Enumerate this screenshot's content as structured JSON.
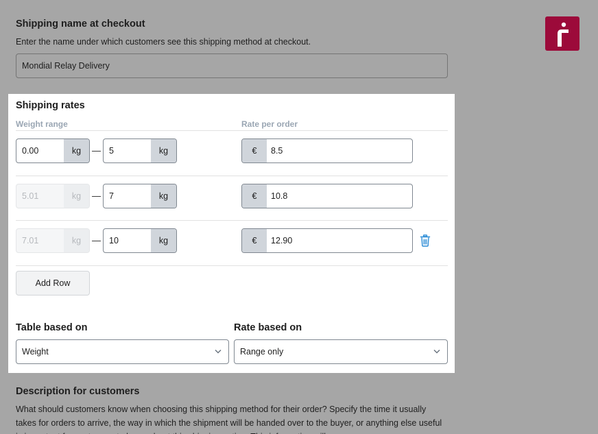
{
  "shipping_name": {
    "title": "Shipping name at checkout",
    "help": "Enter the name under which customers see this shipping method at checkout.",
    "value": "Mondial Relay Delivery"
  },
  "logo": {
    "name": "mondial-relay-logo",
    "color": "#9c0a3a"
  },
  "rates": {
    "title": "Shipping rates",
    "col_weight": "Weight range",
    "col_rate": "Rate per order",
    "rows": [
      {
        "from": "0.00",
        "from_unit": "kg",
        "to": "5",
        "to_unit": "kg",
        "currency": "€",
        "rate": "8.5"
      },
      {
        "from": "5.01",
        "from_unit": "kg",
        "to": "7",
        "to_unit": "kg",
        "currency": "€",
        "rate": "10.8"
      },
      {
        "from": "7.01",
        "from_unit": "kg",
        "to": "10",
        "to_unit": "kg",
        "currency": "€",
        "rate": "12.90",
        "delete_icon": "trash-icon"
      }
    ],
    "dash": "—",
    "add_row": "Add Row"
  },
  "table_based_on": {
    "label": "Table based on",
    "value": "Weight"
  },
  "rate_based_on": {
    "label": "Rate based on",
    "value": "Range only"
  },
  "description": {
    "title": "Description for customers",
    "text": "What should customers know when choosing this shipping method for their order? Specify the time it usually takes for orders to arrive, the way in which the shipment will be handed over to the buyer, or anything else useful is important for customers to know about this shipping option. This information will"
  }
}
